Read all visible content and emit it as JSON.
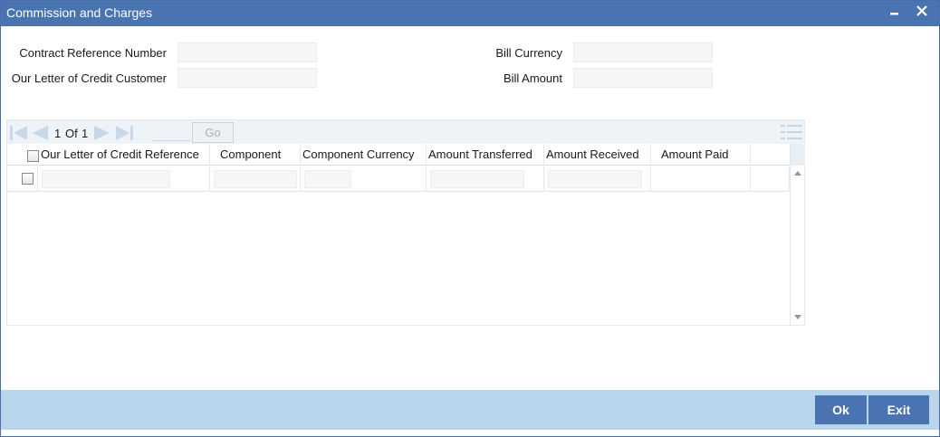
{
  "window": {
    "title": "Commission and Charges",
    "minimize_icon": "minimize-icon",
    "close_icon": "close-icon"
  },
  "form": {
    "contract_reference_label": "Contract Reference Number",
    "contract_reference_value": "",
    "customer_label": "Our Letter of Credit Customer",
    "customer_value": "",
    "bill_currency_label": "Bill Currency",
    "bill_currency_value": "",
    "bill_amount_label": "Bill Amount",
    "bill_amount_value": ""
  },
  "pager": {
    "current": "1",
    "of_label": "Of",
    "total": "1",
    "page_input": "",
    "go_label": "Go"
  },
  "grid": {
    "columns": [
      "Our Letter of Credit Reference",
      "Component",
      "Component Currency",
      "Amount Transferred",
      "Amount Received",
      "Amount Paid"
    ],
    "rows": [
      {
        "reference": "",
        "component": "",
        "currency": "",
        "transferred": "",
        "received": "",
        "paid": ""
      }
    ]
  },
  "footer": {
    "ok_label": "Ok",
    "exit_label": "Exit"
  },
  "colors": {
    "titlebar": "#4a73b1",
    "footer": "#b9d5ec",
    "button": "#4a73b1",
    "nav_icon": "#c9d8e8"
  }
}
